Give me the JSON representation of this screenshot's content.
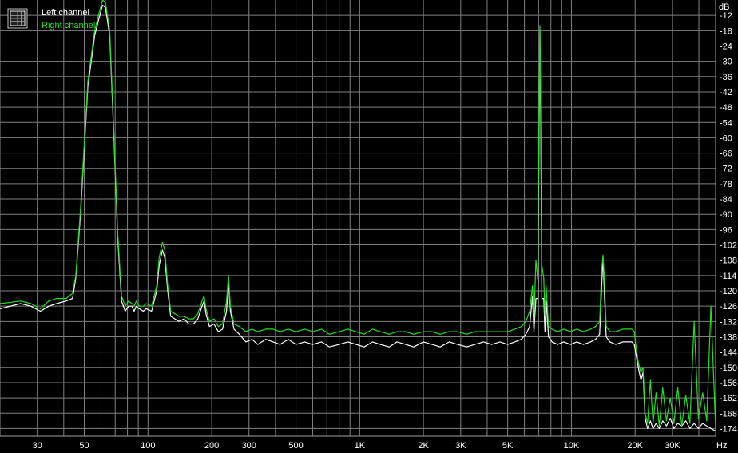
{
  "chart_data": {
    "type": "line",
    "title": "",
    "xlabel": "Hz",
    "ylabel": "dB",
    "x_scale": "log",
    "xlim": [
      20,
      48000
    ],
    "ylim": [
      -177,
      -6
    ],
    "grid": true,
    "legend_position": "top-left",
    "legend_icon": "spectrum-grid-icon",
    "x_ticks": [
      {
        "value": 30,
        "label": "30"
      },
      {
        "value": 50,
        "label": "50"
      },
      {
        "value": 100,
        "label": "100"
      },
      {
        "value": 200,
        "label": "200"
      },
      {
        "value": 300,
        "label": "300"
      },
      {
        "value": 500,
        "label": "500"
      },
      {
        "value": 1000,
        "label": "1K"
      },
      {
        "value": 2000,
        "label": "2K"
      },
      {
        "value": 3000,
        "label": "3K"
      },
      {
        "value": 5000,
        "label": "5K"
      },
      {
        "value": 10000,
        "label": "10K"
      },
      {
        "value": 20000,
        "label": "20K"
      },
      {
        "value": 30000,
        "label": "30K"
      }
    ],
    "y_ticks": [
      -12,
      -18,
      -24,
      -30,
      -36,
      -42,
      -48,
      -54,
      -60,
      -66,
      -72,
      -78,
      -84,
      -90,
      -96,
      -102,
      -108,
      -114,
      -120,
      -126,
      -132,
      -138,
      -144,
      -150,
      -156,
      -162,
      -168,
      -174
    ],
    "background_color": "#000000",
    "grid_color": "#808080",
    "series": [
      {
        "name": "Left channel",
        "color": "#ffffff",
        "points": [
          [
            20,
            -127
          ],
          [
            25,
            -125
          ],
          [
            28,
            -126
          ],
          [
            31,
            -128
          ],
          [
            34,
            -126
          ],
          [
            37,
            -125
          ],
          [
            41,
            -124
          ],
          [
            44,
            -123
          ],
          [
            45.6,
            -115
          ],
          [
            48,
            -90
          ],
          [
            52,
            -40
          ],
          [
            56,
            -20
          ],
          [
            58.8,
            -13
          ],
          [
            61,
            -8
          ],
          [
            63,
            -9
          ],
          [
            66,
            -20
          ],
          [
            69,
            -60
          ],
          [
            72,
            -100
          ],
          [
            75,
            -124
          ],
          [
            78,
            -128
          ],
          [
            81,
            -126
          ],
          [
            84,
            -126
          ],
          [
            86,
            -128
          ],
          [
            88,
            -126
          ],
          [
            91,
            -127
          ],
          [
            95,
            -128
          ],
          [
            98,
            -127
          ],
          [
            104,
            -128
          ],
          [
            110,
            -120
          ],
          [
            113,
            -110
          ],
          [
            117,
            -104
          ],
          [
            120,
            -107
          ],
          [
            124,
            -120
          ],
          [
            128,
            -130
          ],
          [
            134,
            -131
          ],
          [
            140,
            -132
          ],
          [
            148,
            -131
          ],
          [
            156,
            -133
          ],
          [
            164,
            -133
          ],
          [
            172,
            -131
          ],
          [
            180,
            -126
          ],
          [
            184,
            -124
          ],
          [
            188,
            -129
          ],
          [
            195,
            -134
          ],
          [
            205,
            -133
          ],
          [
            215,
            -136
          ],
          [
            225,
            -135
          ],
          [
            235,
            -128
          ],
          [
            240,
            -117
          ],
          [
            245,
            -128
          ],
          [
            255,
            -135
          ],
          [
            270,
            -137
          ],
          [
            290,
            -140
          ],
          [
            310,
            -139
          ],
          [
            330,
            -141
          ],
          [
            360,
            -139
          ],
          [
            390,
            -140
          ],
          [
            420,
            -141
          ],
          [
            460,
            -139
          ],
          [
            500,
            -141
          ],
          [
            550,
            -140
          ],
          [
            600,
            -141
          ],
          [
            660,
            -140
          ],
          [
            720,
            -142
          ],
          [
            800,
            -141
          ],
          [
            880,
            -140
          ],
          [
            960,
            -141
          ],
          [
            1050,
            -142
          ],
          [
            1150,
            -140
          ],
          [
            1250,
            -141
          ],
          [
            1380,
            -142
          ],
          [
            1500,
            -140
          ],
          [
            1650,
            -141
          ],
          [
            1800,
            -142
          ],
          [
            2000,
            -140
          ],
          [
            2200,
            -141
          ],
          [
            2400,
            -142
          ],
          [
            2650,
            -140
          ],
          [
            2900,
            -141
          ],
          [
            3200,
            -142
          ],
          [
            3500,
            -141
          ],
          [
            3850,
            -140
          ],
          [
            4200,
            -141
          ],
          [
            4600,
            -140
          ],
          [
            5000,
            -141
          ],
          [
            5400,
            -140
          ],
          [
            5800,
            -139
          ],
          [
            6100,
            -137
          ],
          [
            6350,
            -134
          ],
          [
            6550,
            -122
          ],
          [
            6650,
            -136
          ],
          [
            6800,
            -123
          ],
          [
            6950,
            -123
          ],
          [
            7000,
            -80
          ],
          [
            7100,
            -18
          ],
          [
            7200,
            -80
          ],
          [
            7250,
            -123
          ],
          [
            7400,
            -123
          ],
          [
            7500,
            -136
          ],
          [
            7600,
            -124
          ],
          [
            7800,
            -138
          ],
          [
            8100,
            -140
          ],
          [
            8600,
            -141
          ],
          [
            9200,
            -140
          ],
          [
            9900,
            -141
          ],
          [
            10600,
            -140
          ],
          [
            11400,
            -141
          ],
          [
            12300,
            -140
          ],
          [
            13000,
            -139
          ],
          [
            13600,
            -137
          ],
          [
            13900,
            -118
          ],
          [
            14100,
            -107
          ],
          [
            14300,
            -120
          ],
          [
            14600,
            -138
          ],
          [
            15200,
            -140
          ],
          [
            16200,
            -141
          ],
          [
            17500,
            -140
          ],
          [
            18500,
            -140
          ],
          [
            19300,
            -140
          ],
          [
            19800,
            -141
          ],
          [
            20200,
            -145
          ],
          [
            20700,
            -150
          ],
          [
            21300,
            -155
          ],
          [
            21800,
            -152
          ],
          [
            22300,
            -170
          ],
          [
            22900,
            -174
          ],
          [
            23600,
            -171
          ],
          [
            24300,
            -174
          ],
          [
            25100,
            -172
          ],
          [
            26000,
            -174
          ],
          [
            27000,
            -171
          ],
          [
            28100,
            -173
          ],
          [
            29300,
            -170
          ],
          [
            30500,
            -174
          ],
          [
            31800,
            -172
          ],
          [
            33200,
            -173
          ],
          [
            34700,
            -171
          ],
          [
            36300,
            -174
          ],
          [
            38000,
            -172
          ],
          [
            39800,
            -174
          ],
          [
            41700,
            -172
          ],
          [
            43600,
            -173
          ],
          [
            45600,
            -174
          ],
          [
            48000,
            -175
          ]
        ]
      },
      {
        "name": "Right channel",
        "color": "#22dd22",
        "points": [
          [
            20,
            -125
          ],
          [
            25,
            -124
          ],
          [
            28,
            -125
          ],
          [
            31,
            -127
          ],
          [
            34,
            -124
          ],
          [
            37,
            -123
          ],
          [
            41,
            -123
          ],
          [
            44,
            -121
          ],
          [
            45.6,
            -114
          ],
          [
            48,
            -88
          ],
          [
            52,
            -38
          ],
          [
            56,
            -18
          ],
          [
            58.8,
            -11
          ],
          [
            61,
            -6
          ],
          [
            63,
            -7
          ],
          [
            66,
            -18
          ],
          [
            69,
            -58
          ],
          [
            72,
            -98
          ],
          [
            75,
            -122
          ],
          [
            78,
            -126
          ],
          [
            81,
            -124
          ],
          [
            84,
            -125
          ],
          [
            86,
            -126
          ],
          [
            88,
            -124
          ],
          [
            91,
            -126
          ],
          [
            95,
            -126
          ],
          [
            98,
            -125
          ],
          [
            104,
            -126
          ],
          [
            110,
            -118
          ],
          [
            113,
            -107
          ],
          [
            117,
            -101
          ],
          [
            120,
            -104
          ],
          [
            124,
            -118
          ],
          [
            128,
            -128
          ],
          [
            134,
            -129
          ],
          [
            140,
            -130
          ],
          [
            148,
            -130
          ],
          [
            156,
            -131
          ],
          [
            164,
            -131
          ],
          [
            172,
            -129
          ],
          [
            180,
            -124
          ],
          [
            184,
            -122
          ],
          [
            188,
            -127
          ],
          [
            195,
            -132
          ],
          [
            205,
            -131
          ],
          [
            215,
            -134
          ],
          [
            225,
            -133
          ],
          [
            235,
            -124
          ],
          [
            240,
            -114
          ],
          [
            245,
            -126
          ],
          [
            255,
            -133
          ],
          [
            270,
            -134
          ],
          [
            290,
            -136
          ],
          [
            310,
            -135
          ],
          [
            330,
            -136
          ],
          [
            360,
            -135
          ],
          [
            390,
            -135
          ],
          [
            420,
            -136
          ],
          [
            460,
            -135
          ],
          [
            500,
            -136
          ],
          [
            550,
            -135
          ],
          [
            600,
            -136
          ],
          [
            660,
            -135
          ],
          [
            720,
            -137
          ],
          [
            800,
            -136
          ],
          [
            880,
            -135
          ],
          [
            960,
            -136
          ],
          [
            1050,
            -137
          ],
          [
            1150,
            -135
          ],
          [
            1250,
            -136
          ],
          [
            1380,
            -137
          ],
          [
            1500,
            -136
          ],
          [
            1650,
            -136
          ],
          [
            1800,
            -137
          ],
          [
            2000,
            -136
          ],
          [
            2200,
            -136
          ],
          [
            2400,
            -137
          ],
          [
            2650,
            -136
          ],
          [
            2900,
            -136
          ],
          [
            3200,
            -137
          ],
          [
            3500,
            -136
          ],
          [
            3850,
            -136
          ],
          [
            4200,
            -136
          ],
          [
            4600,
            -136
          ],
          [
            5000,
            -136
          ],
          [
            5400,
            -135
          ],
          [
            5800,
            -134
          ],
          [
            6100,
            -132
          ],
          [
            6350,
            -128
          ],
          [
            6550,
            -118
          ],
          [
            6650,
            -132
          ],
          [
            6800,
            -108
          ],
          [
            6950,
            -116
          ],
          [
            7000,
            -70
          ],
          [
            7100,
            -16
          ],
          [
            7200,
            -70
          ],
          [
            7250,
            -110
          ],
          [
            7400,
            -115
          ],
          [
            7500,
            -130
          ],
          [
            7600,
            -118
          ],
          [
            7800,
            -134
          ],
          [
            8100,
            -135
          ],
          [
            8600,
            -136
          ],
          [
            9200,
            -135
          ],
          [
            9900,
            -136
          ],
          [
            10600,
            -135
          ],
          [
            11400,
            -136
          ],
          [
            12300,
            -135
          ],
          [
            13000,
            -134
          ],
          [
            13600,
            -132
          ],
          [
            13900,
            -112
          ],
          [
            14100,
            -106
          ],
          [
            14300,
            -115
          ],
          [
            14600,
            -134
          ],
          [
            15200,
            -136
          ],
          [
            16200,
            -136
          ],
          [
            17500,
            -135
          ],
          [
            18500,
            -135
          ],
          [
            19300,
            -135
          ],
          [
            19800,
            -136
          ],
          [
            20200,
            -142
          ],
          [
            20700,
            -148
          ],
          [
            21300,
            -152
          ],
          [
            21800,
            -150
          ],
          [
            22300,
            -168
          ],
          [
            22900,
            -172
          ],
          [
            23600,
            -155
          ],
          [
            24300,
            -172
          ],
          [
            25100,
            -160
          ],
          [
            26000,
            -173
          ],
          [
            27000,
            -158
          ],
          [
            28100,
            -171
          ],
          [
            29300,
            -162
          ],
          [
            30500,
            -172
          ],
          [
            31800,
            -158
          ],
          [
            33200,
            -173
          ],
          [
            34700,
            -161
          ],
          [
            36300,
            -172
          ],
          [
            38000,
            -132
          ],
          [
            39800,
            -170
          ],
          [
            41700,
            -160
          ],
          [
            43600,
            -171
          ],
          [
            45600,
            -126
          ],
          [
            48000,
            -174
          ]
        ]
      }
    ]
  }
}
